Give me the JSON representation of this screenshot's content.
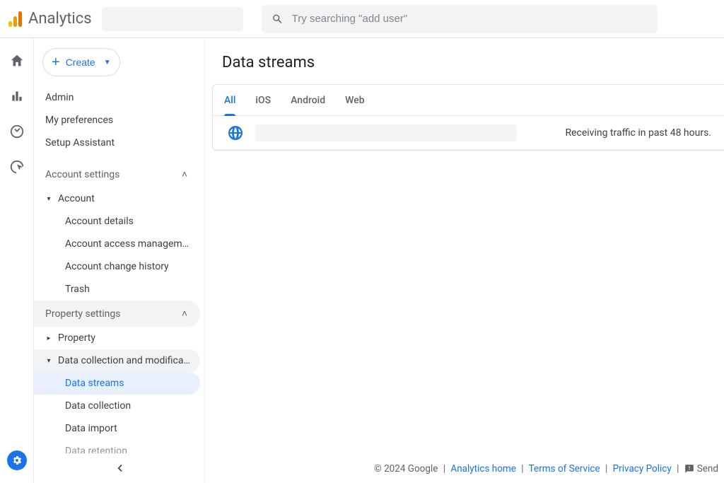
{
  "header": {
    "product_name": "Analytics",
    "search_placeholder": "Try searching \"add user\""
  },
  "create_button": {
    "label": "Create"
  },
  "top_links": [
    "Admin",
    "My preferences",
    "Setup Assistant"
  ],
  "sections": {
    "account": {
      "header": "Account settings",
      "root": "Account",
      "items": [
        "Account details",
        "Account access managem…",
        "Account change history",
        "Trash"
      ]
    },
    "property": {
      "header": "Property settings",
      "root": "Property",
      "data_collection": {
        "label": "Data collection and modifica…",
        "items": [
          "Data streams",
          "Data collection",
          "Data import",
          "Data retention"
        ]
      }
    }
  },
  "page": {
    "title": "Data streams",
    "tabs": [
      "All",
      "iOS",
      "Android",
      "Web"
    ],
    "active_tab": 0,
    "row_status": "Receiving traffic in past 48 hours."
  },
  "footer": {
    "copyright": "© 2024 Google",
    "links": [
      "Analytics home",
      "Terms of Service",
      "Privacy Policy"
    ],
    "feedback": "Send"
  }
}
